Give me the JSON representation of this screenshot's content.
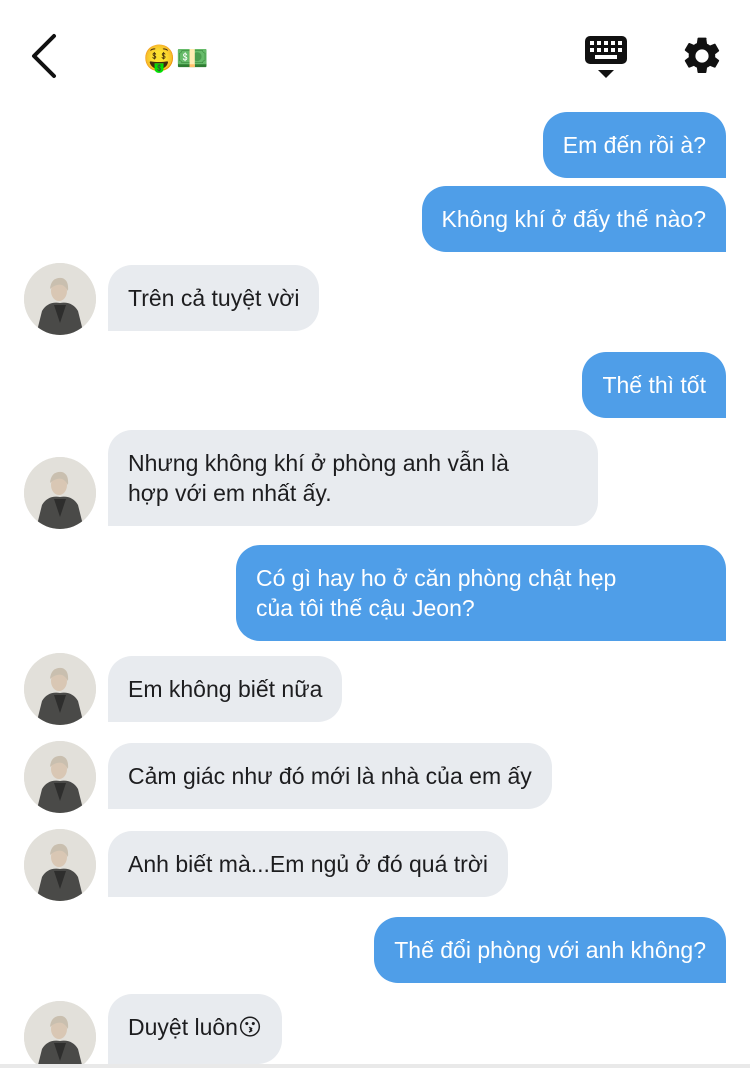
{
  "header": {
    "title": "🤑💵"
  },
  "messages": [
    {
      "side": "out",
      "text": "Em đến rồi à?"
    },
    {
      "side": "out",
      "text": "Không khí ở đấy thế nào?"
    },
    {
      "side": "in",
      "text": "Trên cả tuyệt vời"
    },
    {
      "side": "out",
      "text": "Thế thì tốt"
    },
    {
      "side": "in",
      "line1": "Nhưng không khí ở phòng anh vẫn là",
      "line2": "hợp với em nhất ấy."
    },
    {
      "side": "out",
      "line1": "Có gì hay ho ở căn phòng chật hẹp",
      "line2": "của tôi thế cậu Jeon?"
    },
    {
      "side": "in",
      "text": "Em không biết nữa"
    },
    {
      "side": "in",
      "text": "Cảm giác như đó mới là nhà của em ấy"
    },
    {
      "side": "in",
      "text": "Anh biết mà...Em ngủ ở đó quá trời"
    },
    {
      "side": "out",
      "text": "Thế đổi phòng với anh không?"
    },
    {
      "side": "in",
      "text": "Duyệt luôn",
      "emoji": "😗"
    }
  ],
  "colors": {
    "outgoing_bubble": "#4f9ee8",
    "incoming_bubble": "#e8ebef"
  },
  "icons": {
    "back": "chevron-left-icon",
    "keyboard": "keyboard-icon",
    "settings": "gear-icon"
  }
}
